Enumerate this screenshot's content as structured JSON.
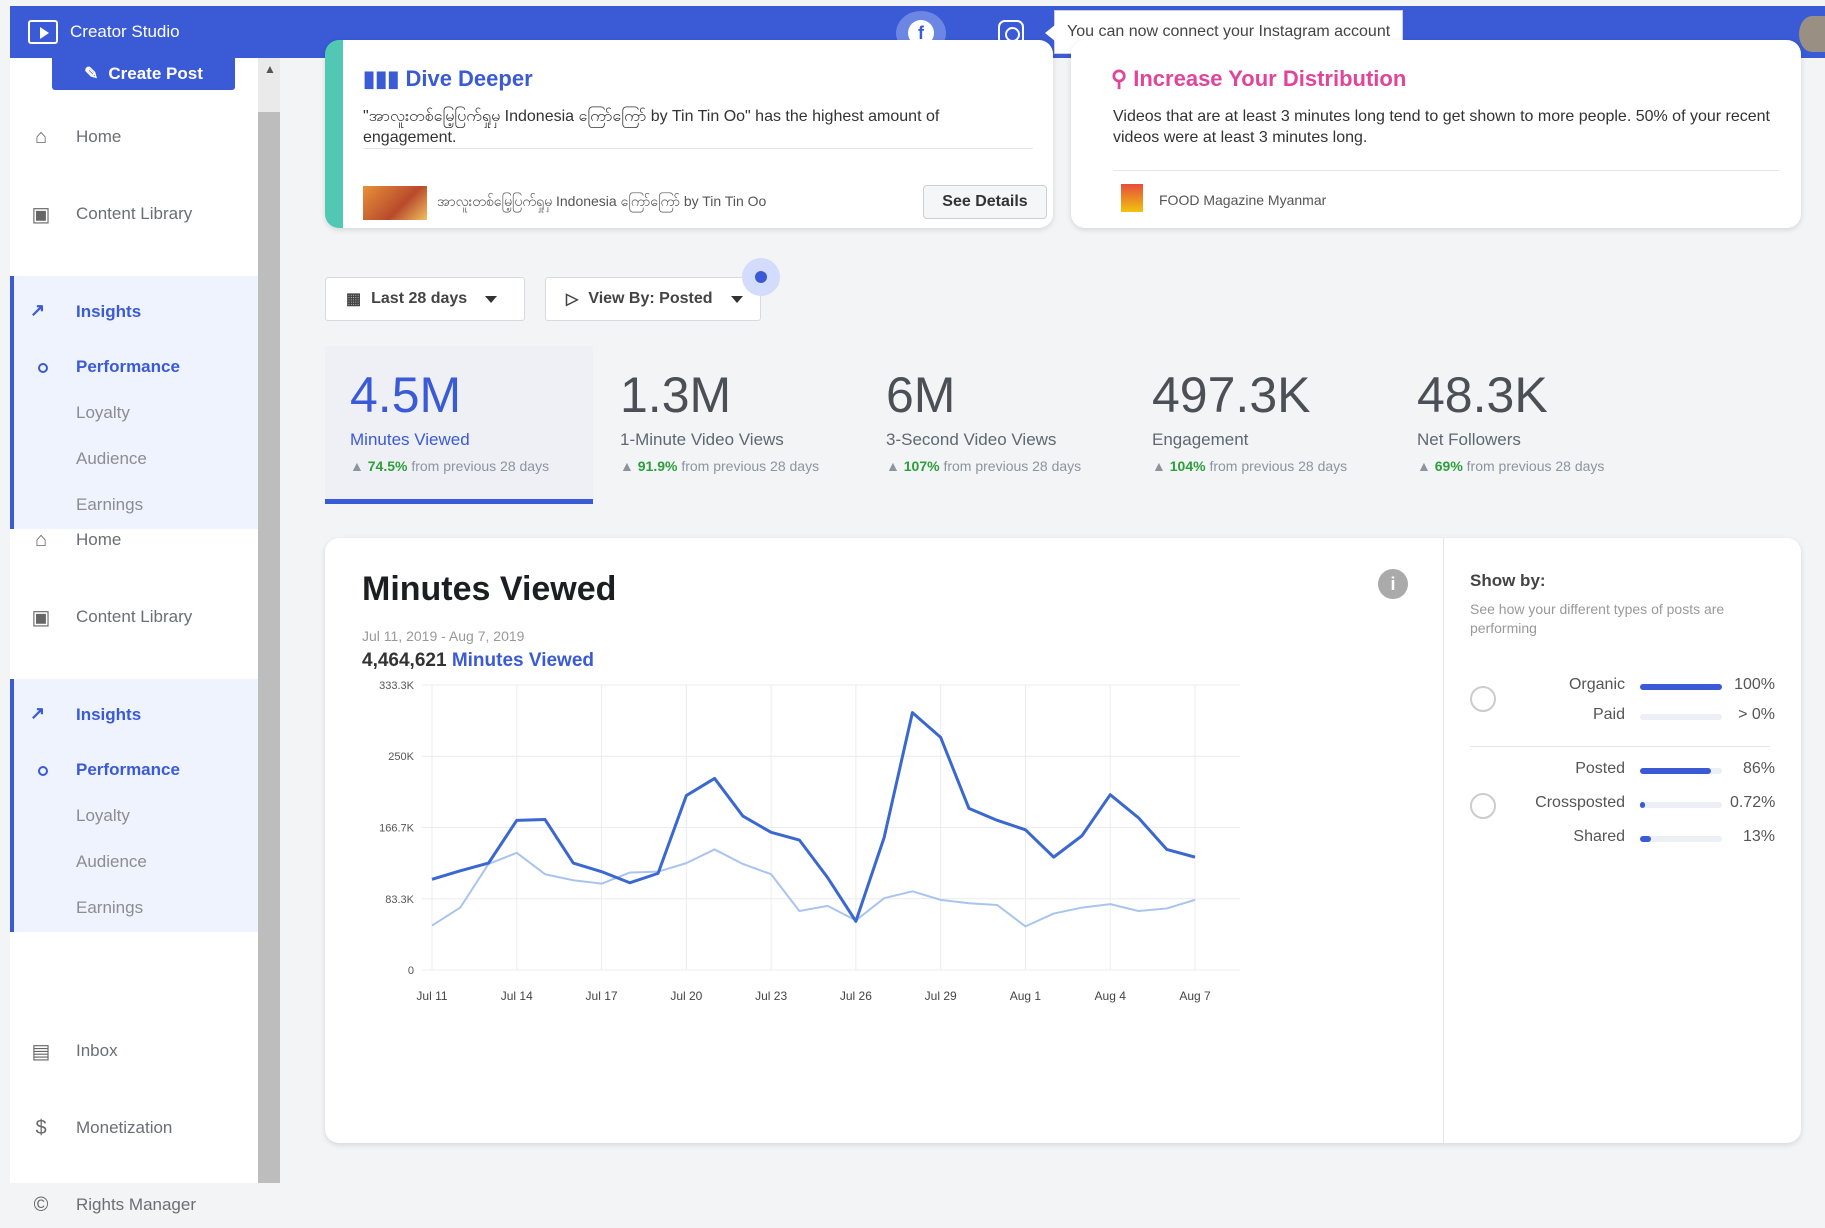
{
  "app": {
    "title": "Creator Studio",
    "tooltip": "You can now connect your Instagram account"
  },
  "sidebar": {
    "create_post": "Create Post",
    "sections": [
      {
        "home": "Home",
        "content_library": "Content Library",
        "insights": "Insights",
        "performance": "Performance",
        "loyalty": "Loyalty",
        "audience": "Audience",
        "earnings": "Earnings"
      },
      {
        "home": "Home",
        "content_library": "Content Library",
        "insights": "Insights",
        "performance": "Performance",
        "loyalty": "Loyalty",
        "audience": "Audience",
        "earnings": "Earnings"
      }
    ],
    "inbox": "Inbox",
    "monetization": "Monetization",
    "rights_manager": "Rights Manager"
  },
  "cards": {
    "dive_deeper": {
      "title": "Dive Deeper",
      "text": "\"အာလူးတစ်မြေ့ပြက်ရှုမှ Indonesia ကြော်ကြော် by Tin Tin Oo\" has the highest amount of engagement.",
      "post_label": "အာလူးတစ်မြေ့ပြက်ရှုမှ Indonesia ကြော်ကြော် by Tin Tin Oo",
      "button": "See Details",
      "accent": "#50c8b4"
    },
    "distribution": {
      "title": "Increase Your Distribution",
      "text": "Videos that are at least 3 minutes long tend to get shown to more people. 50% of your recent videos were at least 3 minutes long.",
      "page_label": "FOOD Magazine Myanmar",
      "accent": "#e0459b"
    }
  },
  "filters": {
    "date_range": "Last 28 days",
    "view_by": "View By: Posted"
  },
  "metrics": [
    {
      "value": "4.5M",
      "label": "Minutes Viewed",
      "change": "74.5%",
      "suffix": "from previous 28 days"
    },
    {
      "value": "1.3M",
      "label": "1-Minute Video Views",
      "change": "91.9%",
      "suffix": "from previous 28 days"
    },
    {
      "value": "6M",
      "label": "3-Second Video Views",
      "change": "107%",
      "suffix": "from previous 28 days"
    },
    {
      "value": "497.3K",
      "label": "Engagement",
      "change": "104%",
      "suffix": "from previous 28 days"
    },
    {
      "value": "48.3K",
      "label": "Net Followers",
      "change": "69%",
      "suffix": "from previous 28 days"
    }
  ],
  "chart": {
    "title": "Minutes Viewed",
    "range": "Jul 11, 2019 - Aug 7, 2019",
    "total_value": "4,464,621",
    "total_label": "Minutes Viewed"
  },
  "chart_data": {
    "type": "line",
    "title": "Minutes Viewed",
    "x": [
      "Jul 11",
      "Jul 12",
      "Jul 13",
      "Jul 14",
      "Jul 15",
      "Jul 16",
      "Jul 17",
      "Jul 18",
      "Jul 19",
      "Jul 20",
      "Jul 21",
      "Jul 22",
      "Jul 23",
      "Jul 24",
      "Jul 25",
      "Jul 26",
      "Jul 27",
      "Jul 28",
      "Jul 29",
      "Jul 30",
      "Jul 31",
      "Aug 1",
      "Aug 2",
      "Aug 3",
      "Aug 4",
      "Aug 5",
      "Aug 6",
      "Aug 7"
    ],
    "x_ticks": [
      "Jul 11",
      "Jul 14",
      "Jul 17",
      "Jul 20",
      "Jul 23",
      "Jul 26",
      "Jul 29",
      "Aug 1",
      "Aug 4",
      "Aug 7"
    ],
    "y_ticks": [
      "0",
      "83.3K",
      "166.7K",
      "250K",
      "333.3K"
    ],
    "ylim": [
      0,
      333300
    ],
    "grid": true,
    "series": [
      {
        "color": "#3a68d0",
        "values": [
          106000,
          116000,
          125000,
          175000,
          176000,
          125000,
          115000,
          102000,
          113000,
          204000,
          224000,
          180000,
          161000,
          152000,
          108000,
          57000,
          155000,
          301000,
          272000,
          189000,
          175000,
          164000,
          132000,
          157000,
          205000,
          178000,
          141000,
          132000
        ]
      },
      {
        "color": "#a9c4ee",
        "values": [
          52000,
          73000,
          124000,
          137000,
          112000,
          105000,
          101000,
          114000,
          115000,
          125000,
          141000,
          124000,
          112000,
          69000,
          75000,
          58000,
          84000,
          92000,
          82000,
          78000,
          76000,
          51000,
          66000,
          73000,
          77000,
          69000,
          72000,
          82000
        ]
      }
    ]
  },
  "show_by": {
    "title": "Show by:",
    "subtitle": "See how your different types of posts are performing",
    "group1": [
      {
        "label": "Organic",
        "pct": "100%",
        "fill": 1.0
      },
      {
        "label": "Paid",
        "pct": "> 0%",
        "fill": 0.0
      }
    ],
    "group2": [
      {
        "label": "Posted",
        "pct": "86%",
        "fill": 0.86
      },
      {
        "label": "Crossposted",
        "pct": "0.72%",
        "fill": 0.0072
      },
      {
        "label": "Shared",
        "pct": "13%",
        "fill": 0.13
      }
    ]
  }
}
